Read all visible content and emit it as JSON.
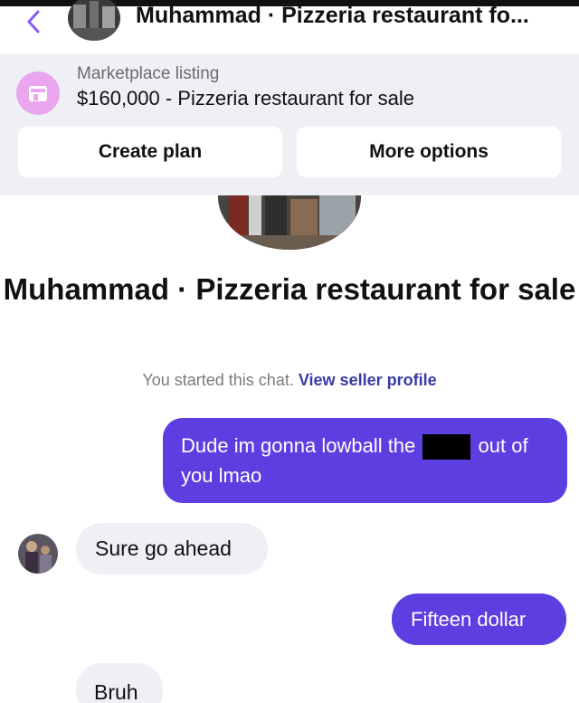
{
  "header": {
    "title": "Muhammad · Pizzeria restaurant fo..."
  },
  "listing": {
    "label": "Marketplace listing",
    "title": "$160,000 - Pizzeria restaurant for sale",
    "icon": "storefront-icon",
    "icon_color": "#e9a6ee"
  },
  "actions": {
    "create_plan": "Create plan",
    "more_options": "More options"
  },
  "chat": {
    "title": "Muhammad · Pizzeria restaurant for sale",
    "started_note": "You started this chat.",
    "view_seller": "View seller profile"
  },
  "messages": [
    {
      "from": "me",
      "text_before": "Dude im gonna lowball the",
      "text_after": "out of you lmao"
    },
    {
      "from": "seller",
      "text": "Sure go ahead"
    },
    {
      "from": "me",
      "text": "Fifteen dollar"
    },
    {
      "from": "seller",
      "text": "Bruh"
    }
  ],
  "colors": {
    "outgoing_bubble": "#5d3ee0",
    "incoming_bubble": "#eef0f5",
    "accent": "#8a5cf6"
  }
}
